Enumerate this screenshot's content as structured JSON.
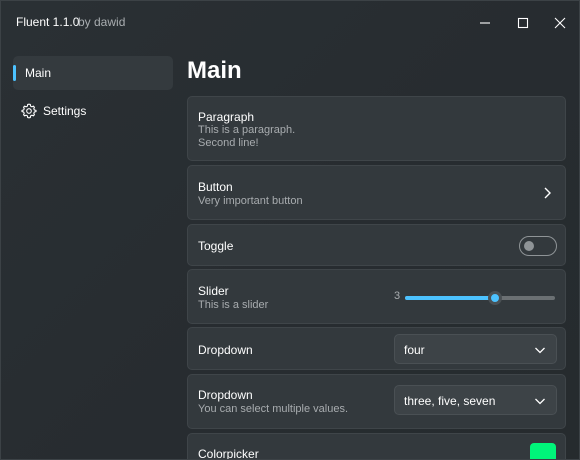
{
  "window": {
    "title": "Fluent 1.1.0",
    "subtitle": "by dawid",
    "controls": {
      "minimize": "minimize",
      "maximize": "maximize",
      "close": "close"
    }
  },
  "sidebar": {
    "items": [
      {
        "label": "Main",
        "selected": true
      },
      {
        "label": "Settings",
        "icon": "gear-icon",
        "selected": false
      }
    ]
  },
  "main": {
    "title": "Main",
    "cards": {
      "paragraph": {
        "title": "Paragraph",
        "description_line1": "This is a paragraph.",
        "description_line2": "Second line!"
      },
      "button": {
        "title": "Button",
        "description": "Very important button",
        "icon": "chevron-right-icon"
      },
      "toggle": {
        "title": "Toggle",
        "value": false
      },
      "slider": {
        "title": "Slider",
        "description": "This is a slider",
        "value": "3",
        "fraction": 0.6
      },
      "dropdown": {
        "title": "Dropdown",
        "selected": "four"
      },
      "dropdown_multi": {
        "title": "Dropdown",
        "description": "You can select multiple values.",
        "selected": "three, five, seven"
      },
      "colorpicker": {
        "title": "Colorpicker",
        "color": "#00f57a"
      }
    }
  },
  "colors": {
    "accent": "#4cc2ff",
    "background": "#272c30",
    "card": "#33393d"
  }
}
